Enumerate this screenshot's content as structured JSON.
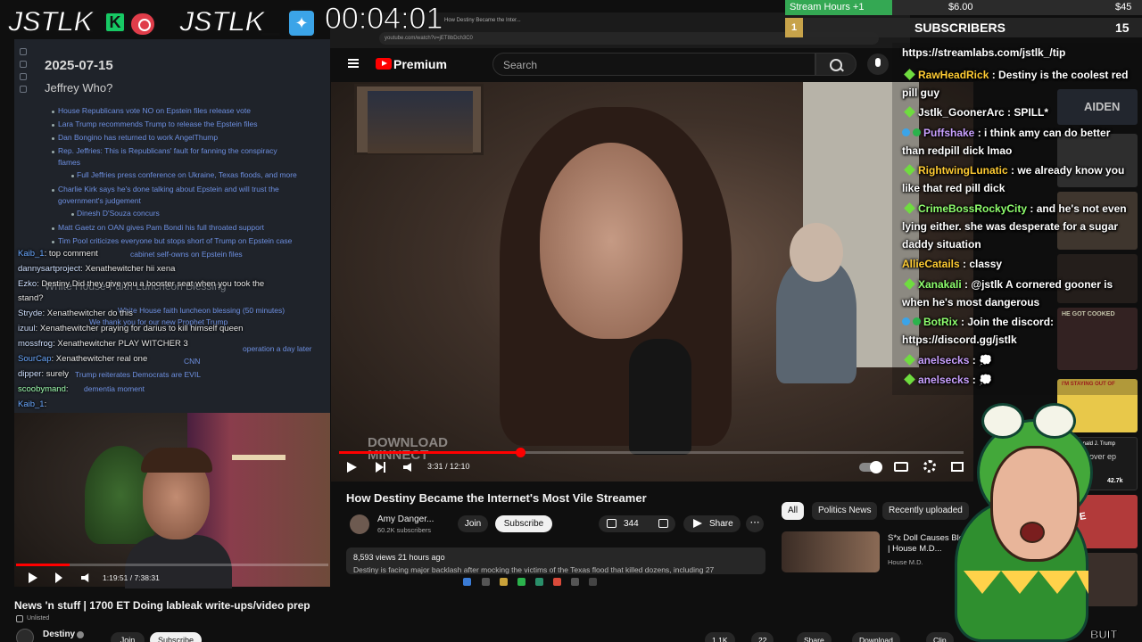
{
  "overlay": {
    "logo_left": "JSTLK",
    "logo_right": "JSTLK_",
    "k_badge": "K",
    "timer": "00:04:01"
  },
  "goals": {
    "stream_hours": "Stream Hours +1",
    "amount1": "$6.00",
    "amount2": "$45",
    "subs_rank": "1",
    "subs_label": "SUBSCRIBERS",
    "subs_count": "15"
  },
  "doc": {
    "date": "2025-07-15",
    "heading": "Jeffrey Who?",
    "links": [
      "House Republicans vote NO on Epstein files release vote",
      "Lara Trump recommends Trump to release the Epstein files",
      "Dan Bongino has returned to work AngelThump",
      "Rep. Jeffries: This is Republicans' fault for fanning the conspiracy",
      "flames",
      "Full Jeffries press conference on Ukraine, Texas floods, and more",
      "Charlie Kirk says he's done talking about Epstein and will trust the",
      "government's judgement",
      "Dinesh D'Souza concurs",
      "Matt Gaetz on OAN gives Pam Bondi his full throated support",
      "Tim Pool criticizes everyone but stops short of Trump on Epstein case",
      "cabinet self-owns on Epstein files",
      "White House faith luncheon blessing (50 minutes)",
      "We thank you for our new Prophet Trump",
      "operation a day later",
      "CNN",
      "Trump reiterates Democrats are EVIL",
      "dementia moment"
    ],
    "subheading": "White House Faith Luncheon Blessing"
  },
  "left_chat": [
    {
      "user": "Kaib_1",
      "msg": "top comment"
    },
    {
      "user": "dannysartproject",
      "msg": "Xenathewitcher hii xena"
    },
    {
      "user": "Ezko",
      "msg": "Destiny Did they give you a booster seat when you took the"
    },
    {
      "user": "",
      "msg": "stand?"
    },
    {
      "user": "Stryde",
      "msg": "Xenathewitcher do this"
    },
    {
      "user": "izuul",
      "msg": "Xenathewitcher praying for darius to kill himself queen"
    },
    {
      "user": "mossfrog",
      "msg": "Xenathewitcher PLAY WITCHER 3"
    },
    {
      "user": "SourCap",
      "msg": "Xenathewitcher real one"
    },
    {
      "user": "dipper",
      "msg": "surely"
    },
    {
      "user": "scoobymand",
      "msg": ""
    },
    {
      "user": "Kaib_1",
      "msg": ""
    }
  ],
  "browser": {
    "tab_title": "How Destiny Became the Inter...",
    "url": "youtube.com/watch?v=jET8bDch3C0"
  },
  "youtube": {
    "brand": "Premium",
    "search_placeholder": "Search",
    "video": {
      "watermark_line1": "DOWNLOAD",
      "watermark_line2": "MINNECT",
      "time": "3:31 / 12:10",
      "progress": 0.29,
      "title": "How Destiny Became the Internet's Most Vile Streamer",
      "channel": "Amy Danger...",
      "subscribers": "60.2K subscribers",
      "join": "Join",
      "subscribe": "Subscribe",
      "likes": "344",
      "share": "Share",
      "more": "⋯",
      "views": "8,593 views  21 hours ago",
      "description": "Destiny is facing major backlash after mocking the victims of the Texas flood that killed dozens, including 27"
    },
    "chips": [
      "All",
      "Politics News",
      "Recently uploaded"
    ],
    "recommended": {
      "title_line1": "S*x Doll Causes Bleedin",
      "title_line2": "| House M.D...",
      "channel": "House M.D."
    }
  },
  "webcam": {
    "time": "1:19:51 / 7:38:31",
    "progress": 0.17
  },
  "stream": {
    "title": "News 'n stuff | 1700 ET Doing lableak write-ups/video prep",
    "visibility": "Unlisted",
    "channel": "Destiny",
    "join": "Join",
    "subscribe": "Subscribe",
    "likes": "1.1K",
    "dislikes": "22",
    "share": "Share",
    "download": "Download",
    "clip": "Clip"
  },
  "right_chat": {
    "tip": "https://streamlabs.com/jstlk_/tip",
    "messages": [
      {
        "user": "RawHeadRick",
        "msg": "Destiny is the coolest red pill guy",
        "color": "y"
      },
      {
        "user": "Jstlk_GoonerArc",
        "msg": "SPILL*",
        "color": "w"
      },
      {
        "user": "Puffshake",
        "msg": "i think amy can do better than redpill dick lmao",
        "color": "p"
      },
      {
        "user": "RightwingLunatic",
        "msg": "we already know you like that red pill dick",
        "color": "y"
      },
      {
        "user": "CrimeBossRockyCity",
        "msg": "and he's not even lying either. she was desperate for a sugar daddy situation",
        "color": "g"
      },
      {
        "user": "AllieCatails",
        "msg": "classy",
        "color": "y"
      },
      {
        "user": "Xanakali",
        "msg": "@jstlk A cornered gooner is when he's most dangerous",
        "color": "g"
      },
      {
        "user": "BotRix",
        "msg": "Join the discord: https://discord.gg/jstlk",
        "color": "g"
      },
      {
        "user": "anelsecks",
        "msg": "💭",
        "color": "p"
      },
      {
        "user": "anelsecks",
        "msg": "💭",
        "color": "p"
      }
    ]
  },
  "thumbnails": {
    "aiden": "AIDEN",
    "cooked": "HE GOT COOKED",
    "staying": "I'M STAYING OUT OF",
    "trump": "Donald J. Trump",
    "trump_text": "get over ep",
    "trump_count": "42.7k",
    "live": "LIVE",
    "corner": "BUIT"
  },
  "colors": {
    "accent_red": "#ff0000",
    "goal_green": "#34a853",
    "chat_purple": "#c9a0ff",
    "chat_yellow": "#ffcc33",
    "chat_green": "#8fff6e"
  }
}
